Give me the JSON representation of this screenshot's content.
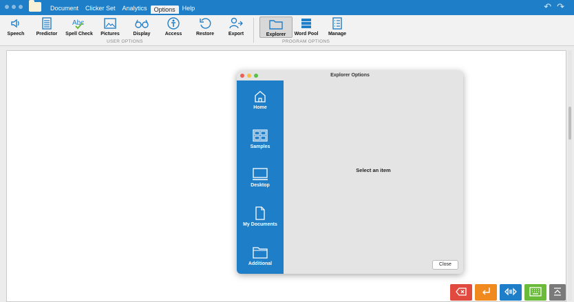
{
  "menu": {
    "items": [
      "Document",
      "Clicker Set",
      "Analytics",
      "Options",
      "Help"
    ],
    "active": "Options"
  },
  "toolbar": {
    "user_tools": [
      {
        "label": "Speech",
        "icon": "speaker-icon"
      },
      {
        "label": "Predictor",
        "icon": "predictor-icon"
      },
      {
        "label": "Spell Check",
        "icon": "spell-check-icon"
      },
      {
        "label": "Pictures",
        "icon": "pictures-icon"
      },
      {
        "label": "Display",
        "icon": "glasses-icon"
      },
      {
        "label": "Access",
        "icon": "accessibility-icon"
      },
      {
        "label": "Restore",
        "icon": "restore-icon"
      },
      {
        "label": "Export",
        "icon": "export-icon"
      }
    ],
    "user_group_label": "USER OPTIONS",
    "program_tools": [
      {
        "label": "Explorer",
        "icon": "explorer-folder-icon",
        "selected": true
      },
      {
        "label": "Word Pool",
        "icon": "word-pool-icon"
      },
      {
        "label": "Manage",
        "icon": "manage-icon"
      }
    ],
    "program_group_label": "PROGRAM OPTIONS"
  },
  "dialog": {
    "title": "Explorer Options",
    "sidebar": [
      {
        "label": "Home",
        "icon": "home-icon"
      },
      {
        "label": "Samples",
        "icon": "samples-icon"
      },
      {
        "label": "Desktop",
        "icon": "desktop-icon"
      },
      {
        "label": "My Documents",
        "icon": "document-icon"
      },
      {
        "label": "Additional",
        "icon": "folder-icon"
      }
    ],
    "placeholder": "Select an item",
    "close_label": "Close"
  },
  "bottom_buttons": [
    {
      "name": "delete-button",
      "icon": "backspace-icon",
      "color": "#e04a3f"
    },
    {
      "name": "enter-button",
      "icon": "return-icon",
      "color": "#f08a1e"
    },
    {
      "name": "speak-button",
      "icon": "speak-icon",
      "color": "#1f7ec8"
    },
    {
      "name": "keyboard-button",
      "icon": "keyboard-icon",
      "color": "#6bbb3a"
    },
    {
      "name": "collapse-button",
      "icon": "collapse-icon",
      "color": "#7a7a7a"
    }
  ]
}
